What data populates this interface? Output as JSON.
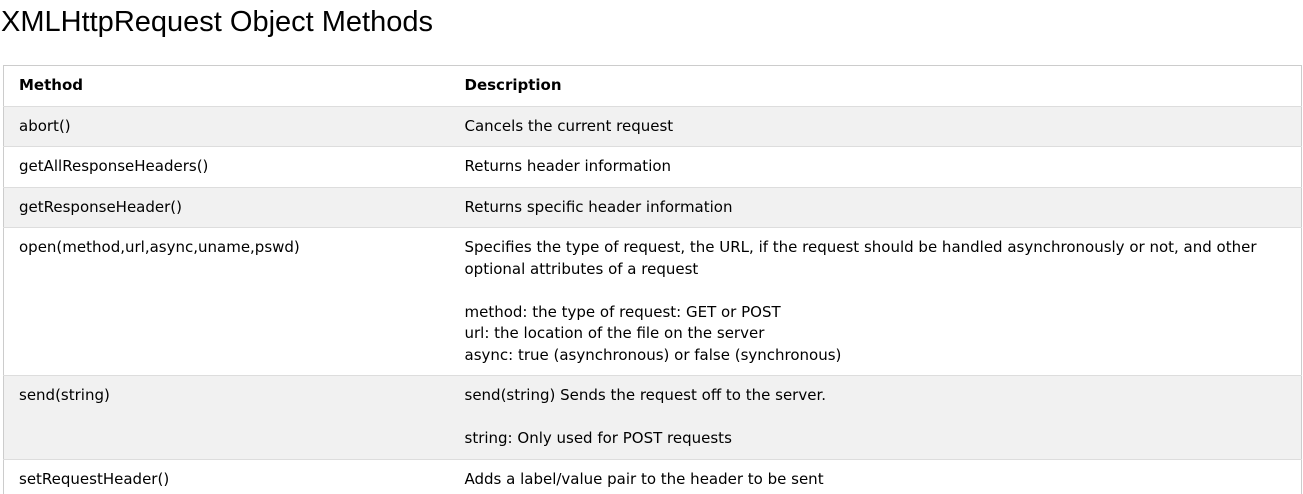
{
  "page": {
    "title": "XMLHttpRequest Object Methods"
  },
  "table": {
    "headers": {
      "method": "Method",
      "description": "Description"
    },
    "rows": [
      {
        "method": "abort()",
        "description": [
          "Cancels the current request"
        ]
      },
      {
        "method": "getAllResponseHeaders()",
        "description": [
          "Returns header information"
        ]
      },
      {
        "method": "getResponseHeader()",
        "description": [
          "Returns specific header information"
        ]
      },
      {
        "method": "open(method,url,async,uname,pswd)",
        "description": [
          "Specifies the type of request, the URL, if the request should be handled asynchronously or not, and other optional attributes of a request",
          "method: the type of request: GET or POST",
          "url: the location of the file on the server",
          "async: true (asynchronous) or false (synchronous)"
        ]
      },
      {
        "method": "send(string)",
        "description": [
          "send(string) Sends the request off to the server.",
          "string: Only used for POST requests"
        ]
      },
      {
        "method": "setRequestHeader()",
        "description": [
          "Adds a label/value pair to the header to be sent"
        ]
      }
    ]
  }
}
